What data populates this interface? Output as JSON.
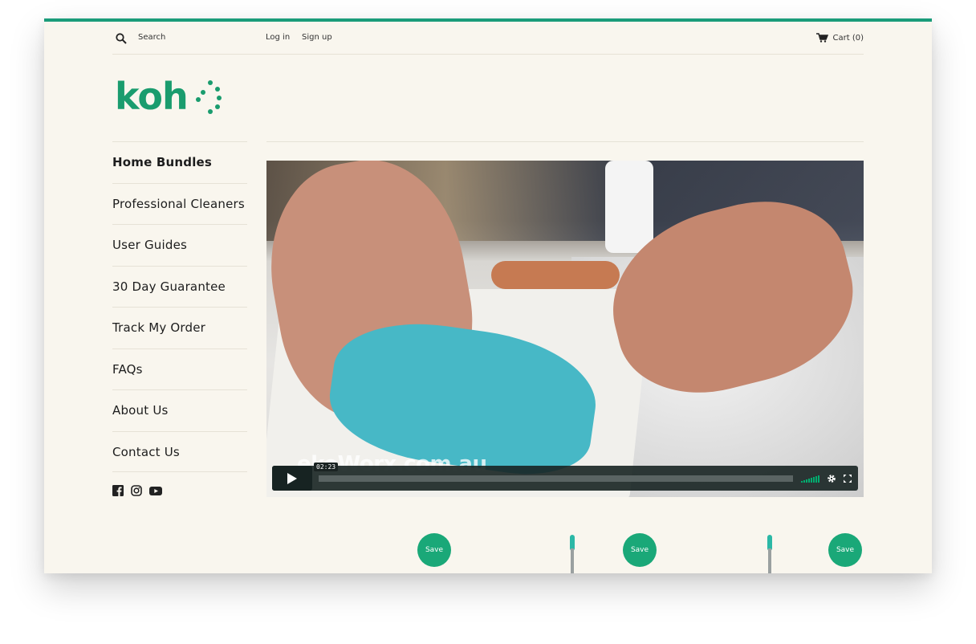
{
  "header": {
    "search_label": "Search",
    "login": "Log in",
    "signup": "Sign up",
    "cart": "Cart (0)"
  },
  "brand": {
    "logo_text": "koh",
    "color": "#1a9c6e"
  },
  "sidebar": {
    "items": [
      {
        "label": "Home Bundles"
      },
      {
        "label": "Professional Cleaners"
      },
      {
        "label": "User Guides"
      },
      {
        "label": "30 Day Guarantee"
      },
      {
        "label": "Track My Order"
      },
      {
        "label": "FAQs"
      },
      {
        "label": "About Us"
      },
      {
        "label": "Contact Us"
      }
    ],
    "social": [
      "facebook-icon",
      "instagram-icon",
      "youtube-icon"
    ]
  },
  "video": {
    "watermark": "ekoWorx.com.au",
    "time": "02:23",
    "accent": "#00ad6f"
  },
  "products": {
    "badges": [
      "Save",
      "Save",
      "Save"
    ]
  }
}
